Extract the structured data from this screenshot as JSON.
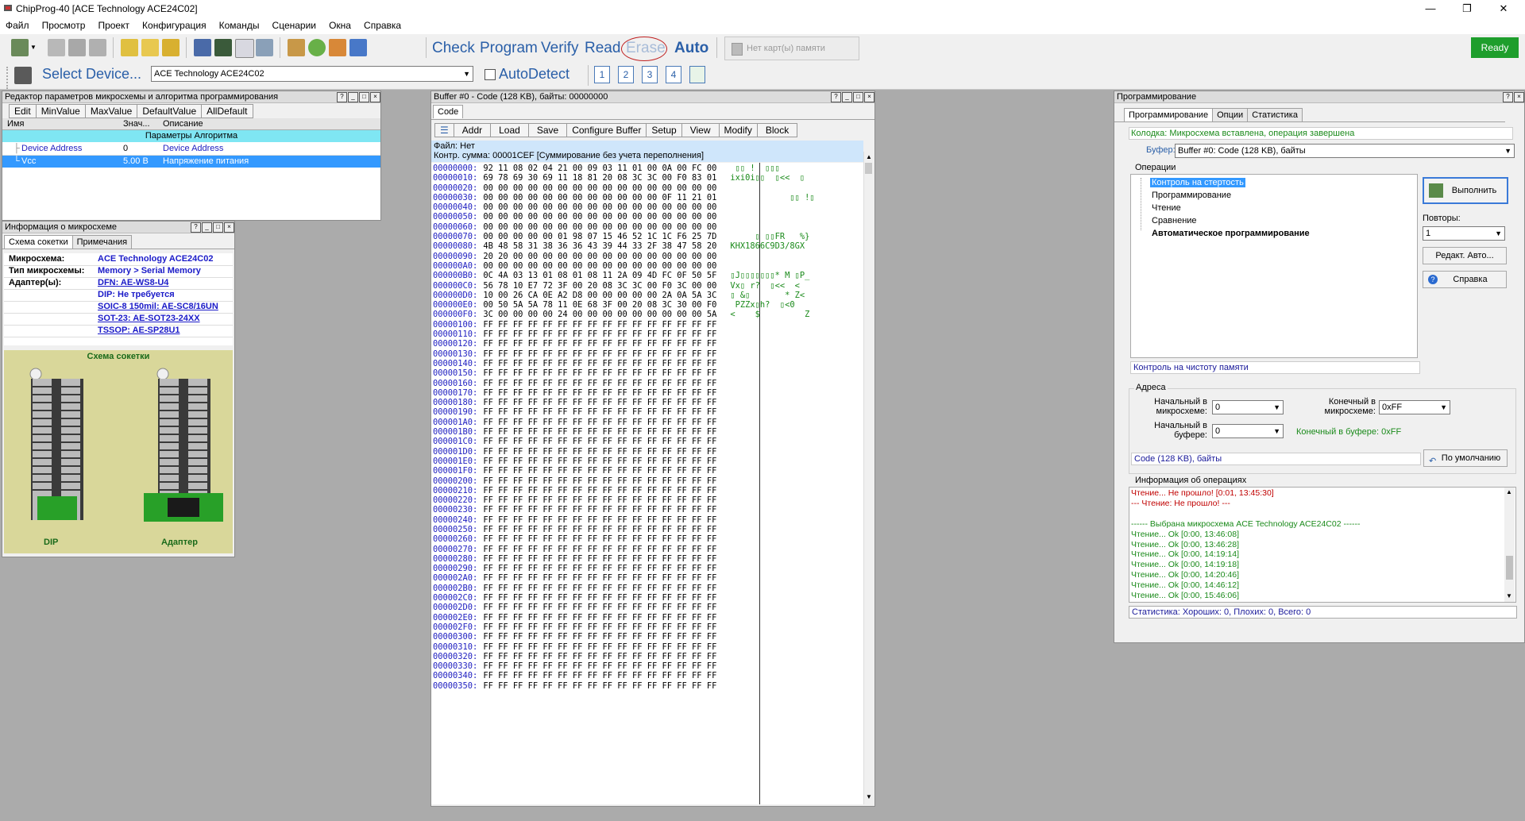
{
  "window": {
    "title": "ChipProg-40 [ACE Technology  ACE24C02]",
    "minimize": "—",
    "maximize": "❐",
    "close": "✕"
  },
  "menu": [
    "Файл",
    "Просмотр",
    "Проект",
    "Конфигурация",
    "Команды",
    "Сценарии",
    "Окна",
    "Справка"
  ],
  "toolbar": {
    "check": "Check",
    "program": "Program",
    "verify": "Verify",
    "read": "Read",
    "erase": "Erase",
    "auto": "Auto",
    "memcard": "Нет карт(ы) памяти",
    "ready": "Ready",
    "select_device": "Select Device...",
    "device_value": "ACE Technology ACE24C02",
    "autodetect": "AutoDetect",
    "site_numbers": [
      "1",
      "2",
      "3",
      "4"
    ]
  },
  "params_panel": {
    "title": "Редактор параметров микросхемы и алгоритма программирования",
    "buttons": [
      "Edit",
      "MinValue",
      "MaxValue",
      "DefaultValue",
      "AllDefault"
    ],
    "columns": [
      "Имя",
      "Знач...",
      "Описание"
    ],
    "group": "Параметры Алгоритма",
    "rows": [
      {
        "name": "Device Address",
        "value": "0",
        "desc": "Device Address"
      },
      {
        "name": "Vcc",
        "value": "5.00 В",
        "desc": "Напряжение питания"
      }
    ]
  },
  "info_panel": {
    "title": "Информация о микросхеме",
    "tabs": [
      "Схема сокетки",
      "Примечания"
    ],
    "rows": [
      {
        "label": "Микросхема:",
        "value": "ACE Technology ACE24C02"
      },
      {
        "label": "Тип микросхемы:",
        "value": "Memory > Serial Memory"
      },
      {
        "label": "Адаптер(ы):",
        "value": "DFN: AE-WS8-U4"
      },
      {
        "label": "",
        "value": "DIP: Не требуется"
      },
      {
        "label": "",
        "value": "SOIC-8 150mil: AE-SC8/16UN"
      },
      {
        "label": "",
        "value": "SOT-23: AE-SOT23-24XX"
      },
      {
        "label": "",
        "value": "TSSOP: AE-SP28U1"
      }
    ],
    "socket_title": "Схема сокетки",
    "label_dip": "DIP",
    "label_adapter": "Адаптер"
  },
  "buffer_panel": {
    "title": "Buffer #0 - Code (128 KB), байты: 00000000",
    "tab": "Code",
    "buttons": [
      "Addr",
      "Load",
      "Save",
      "Configure Buffer",
      "Setup",
      "View",
      "Modify",
      "Block"
    ],
    "file": "Файл: Нет",
    "checksum": "Контр. сумма: 00001CEF  [Суммирование без учета переполнения]",
    "rows": [
      {
        "a": "00000000:",
        "h": "92 11 08 02 04 21 00 09 03 11 01 00 0A 00 FC 00",
        "s": " ▯▯ !  ▯▯▯"
      },
      {
        "a": "00000010:",
        "h": "69 78 69 30 69 11 18 81 20 08 3C 3C 00 F0 83 01",
        "s": "ixi0i▯▯  ▯<<  ▯"
      },
      {
        "a": "00000020:",
        "h": "00 00 00 00 00 00 00 00 00 00 00 00 00 00 00 00",
        "s": ""
      },
      {
        "a": "00000030:",
        "h": "00 00 00 00 00 00 00 00 00 00 00 00 0F 11 21 01",
        "s": "            ▯▯ !▯"
      },
      {
        "a": "00000040:",
        "h": "00 00 00 00 00 00 00 00 00 00 00 00 00 00 00 00",
        "s": ""
      },
      {
        "a": "00000050:",
        "h": "00 00 00 00 00 00 00 00 00 00 00 00 00 00 00 00",
        "s": ""
      },
      {
        "a": "00000060:",
        "h": "00 00 00 00 00 00 00 00 00 00 00 00 00 00 00 00",
        "s": ""
      },
      {
        "a": "00000070:",
        "h": "00 00 00 00 00 01 98 07 15 46 52 1C 1C F6 25 7D",
        "s": "     ▯ ▯▯FR   %}"
      },
      {
        "a": "00000080:",
        "h": "4B 48 58 31 38 36 36 43 39 44 33 2F 38 47 58 20",
        "s": "KHX1866C9D3/8GX "
      },
      {
        "a": "00000090:",
        "h": "20 20 00 00 00 00 00 00 00 00 00 00 00 00 00 00",
        "s": ""
      },
      {
        "a": "000000A0:",
        "h": "00 00 00 00 00 00 00 00 00 00 00 00 00 00 00 00",
        "s": ""
      },
      {
        "a": "000000B0:",
        "h": "0C 4A 03 13 01 08 01 08 11 2A 09 4D FC 0F 50 5F",
        "s": "▯J▯▯▯▯▯▯▯* M ▯P_"
      },
      {
        "a": "000000C0:",
        "h": "56 78 10 E7 72 3F 00 20 08 3C 3C 00 F0 3C 00 00",
        "s": "Vx▯ r?  ▯<<  <"
      },
      {
        "a": "000000D0:",
        "h": "10 00 26 CA 0E A2 D8 00 00 00 00 00 2A 0A 5A 3C",
        "s": "▯ &▯       * Z<"
      },
      {
        "a": "000000E0:",
        "h": "00 50 5A 5A 78 11 0E 68 3F 00 20 08 3C 30 00 F0",
        "s": " PZZx▯h?  ▯<0"
      },
      {
        "a": "000000F0:",
        "h": "3C 00 00 00 00 24 00 00 00 00 00 00 00 00 00 5A",
        "s": "<    $         Z"
      },
      {
        "a": "00000100:",
        "h": "FF FF FF FF FF FF FF FF FF FF FF FF FF FF FF FF",
        "s": ""
      },
      {
        "a": "00000110:",
        "h": "FF FF FF FF FF FF FF FF FF FF FF FF FF FF FF FF",
        "s": ""
      },
      {
        "a": "00000120:",
        "h": "FF FF FF FF FF FF FF FF FF FF FF FF FF FF FF FF",
        "s": ""
      },
      {
        "a": "00000130:",
        "h": "FF FF FF FF FF FF FF FF FF FF FF FF FF FF FF FF",
        "s": ""
      },
      {
        "a": "00000140:",
        "h": "FF FF FF FF FF FF FF FF FF FF FF FF FF FF FF FF",
        "s": ""
      },
      {
        "a": "00000150:",
        "h": "FF FF FF FF FF FF FF FF FF FF FF FF FF FF FF FF",
        "s": ""
      },
      {
        "a": "00000160:",
        "h": "FF FF FF FF FF FF FF FF FF FF FF FF FF FF FF FF",
        "s": ""
      },
      {
        "a": "00000170:",
        "h": "FF FF FF FF FF FF FF FF FF FF FF FF FF FF FF FF",
        "s": ""
      },
      {
        "a": "00000180:",
        "h": "FF FF FF FF FF FF FF FF FF FF FF FF FF FF FF FF",
        "s": ""
      },
      {
        "a": "00000190:",
        "h": "FF FF FF FF FF FF FF FF FF FF FF FF FF FF FF FF",
        "s": ""
      },
      {
        "a": "000001A0:",
        "h": "FF FF FF FF FF FF FF FF FF FF FF FF FF FF FF FF",
        "s": ""
      },
      {
        "a": "000001B0:",
        "h": "FF FF FF FF FF FF FF FF FF FF FF FF FF FF FF FF",
        "s": ""
      },
      {
        "a": "000001C0:",
        "h": "FF FF FF FF FF FF FF FF FF FF FF FF FF FF FF FF",
        "s": ""
      },
      {
        "a": "000001D0:",
        "h": "FF FF FF FF FF FF FF FF FF FF FF FF FF FF FF FF",
        "s": ""
      },
      {
        "a": "000001E0:",
        "h": "FF FF FF FF FF FF FF FF FF FF FF FF FF FF FF FF",
        "s": ""
      },
      {
        "a": "000001F0:",
        "h": "FF FF FF FF FF FF FF FF FF FF FF FF FF FF FF FF",
        "s": ""
      },
      {
        "a": "00000200:",
        "h": "FF FF FF FF FF FF FF FF FF FF FF FF FF FF FF FF",
        "s": ""
      },
      {
        "a": "00000210:",
        "h": "FF FF FF FF FF FF FF FF FF FF FF FF FF FF FF FF",
        "s": ""
      },
      {
        "a": "00000220:",
        "h": "FF FF FF FF FF FF FF FF FF FF FF FF FF FF FF FF",
        "s": ""
      },
      {
        "a": "00000230:",
        "h": "FF FF FF FF FF FF FF FF FF FF FF FF FF FF FF FF",
        "s": ""
      },
      {
        "a": "00000240:",
        "h": "FF FF FF FF FF FF FF FF FF FF FF FF FF FF FF FF",
        "s": ""
      },
      {
        "a": "00000250:",
        "h": "FF FF FF FF FF FF FF FF FF FF FF FF FF FF FF FF",
        "s": ""
      },
      {
        "a": "00000260:",
        "h": "FF FF FF FF FF FF FF FF FF FF FF FF FF FF FF FF",
        "s": ""
      },
      {
        "a": "00000270:",
        "h": "FF FF FF FF FF FF FF FF FF FF FF FF FF FF FF FF",
        "s": ""
      },
      {
        "a": "00000280:",
        "h": "FF FF FF FF FF FF FF FF FF FF FF FF FF FF FF FF",
        "s": ""
      },
      {
        "a": "00000290:",
        "h": "FF FF FF FF FF FF FF FF FF FF FF FF FF FF FF FF",
        "s": ""
      },
      {
        "a": "000002A0:",
        "h": "FF FF FF FF FF FF FF FF FF FF FF FF FF FF FF FF",
        "s": ""
      },
      {
        "a": "000002B0:",
        "h": "FF FF FF FF FF FF FF FF FF FF FF FF FF FF FF FF",
        "s": ""
      },
      {
        "a": "000002C0:",
        "h": "FF FF FF FF FF FF FF FF FF FF FF FF FF FF FF FF",
        "s": ""
      },
      {
        "a": "000002D0:",
        "h": "FF FF FF FF FF FF FF FF FF FF FF FF FF FF FF FF",
        "s": ""
      },
      {
        "a": "000002E0:",
        "h": "FF FF FF FF FF FF FF FF FF FF FF FF FF FF FF FF",
        "s": ""
      },
      {
        "a": "000002F0:",
        "h": "FF FF FF FF FF FF FF FF FF FF FF FF FF FF FF FF",
        "s": ""
      },
      {
        "a": "00000300:",
        "h": "FF FF FF FF FF FF FF FF FF FF FF FF FF FF FF FF",
        "s": ""
      },
      {
        "a": "00000310:",
        "h": "FF FF FF FF FF FF FF FF FF FF FF FF FF FF FF FF",
        "s": ""
      },
      {
        "a": "00000320:",
        "h": "FF FF FF FF FF FF FF FF FF FF FF FF FF FF FF FF",
        "s": ""
      },
      {
        "a": "00000330:",
        "h": "FF FF FF FF FF FF FF FF FF FF FF FF FF FF FF FF",
        "s": ""
      },
      {
        "a": "00000340:",
        "h": "FF FF FF FF FF FF FF FF FF FF FF FF FF FF FF FF",
        "s": ""
      },
      {
        "a": "00000350:",
        "h": "FF FF FF FF FF FF FF FF FF FF FF FF FF FF FF FF",
        "s": ""
      }
    ]
  },
  "prog_panel": {
    "title": "Программирование",
    "tabs": [
      "Программирование",
      "Опции",
      "Статистика"
    ],
    "socket_status": "Колодка: Микросхема вставлена, операция завершена",
    "buffer_label": "Буфер:",
    "buffer_value": "Buffer #0:  Code (128 KB), байты",
    "operations_label": "Операции",
    "operations": [
      "Контроль на стертость",
      "Программирование",
      "Чтение",
      "Сравнение",
      "Автоматическое программирование"
    ],
    "execute": "Выполнить",
    "repeats_label": "Повторы:",
    "repeats_value": "1",
    "edit_auto": "Редакт. Авто...",
    "help": "Справка",
    "current_op": "Контроль на чистоту памяти",
    "address_label": "Адреса",
    "start_chip_label": "Начальный в микросхеме:",
    "start_chip_value": "0",
    "end_chip_label": "Конечный в микросхеме:",
    "end_chip_value": "0xFF",
    "start_buf_label": "Начальный в буфере:",
    "start_buf_value": "0",
    "end_buf_text": "Конечный в буфере:  0xFF",
    "buffer_info": "Code (128 KB), байты",
    "default_button": "По умолчанию",
    "log_label": "Информация об операциях",
    "log": [
      {
        "text": "Чтение...  Не прошло!  [0:01,  13:45:30]",
        "color": "#c00000"
      },
      {
        "text": "--- Чтение: Не прошло! ---",
        "color": "#c00000"
      },
      {
        "text": "",
        "color": "#000"
      },
      {
        "text": "------ Выбрана микросхема ACE Technology ACE24C02 ------",
        "color": "#1a8a1a"
      },
      {
        "text": "Чтение...  Ok  [0:00,  13:46:08]",
        "color": "#1a8a1a"
      },
      {
        "text": "Чтение...  Ok  [0:00,  13:46:28]",
        "color": "#1a8a1a"
      },
      {
        "text": "Чтение...  Ok  [0:00,  14:19:14]",
        "color": "#1a8a1a"
      },
      {
        "text": "Чтение...  Ok  [0:00,  14:19:18]",
        "color": "#1a8a1a"
      },
      {
        "text": "Чтение...  Ok  [0:00,  14:20:46]",
        "color": "#1a8a1a"
      },
      {
        "text": "Чтение...  Ok  [0:00,  14:46:12]",
        "color": "#1a8a1a"
      },
      {
        "text": "Чтение...  Ok  [0:00,  15:46:06]",
        "color": "#1a8a1a"
      }
    ],
    "stats": "Статистика:   Хороших: 0,  Плохих: 0,  Всего: 0"
  },
  "colors": {
    "accent": "#2a5fa8",
    "ready": "#1e9e2c",
    "selection": "#3399ff",
    "group_header": "#7fe6f3"
  }
}
